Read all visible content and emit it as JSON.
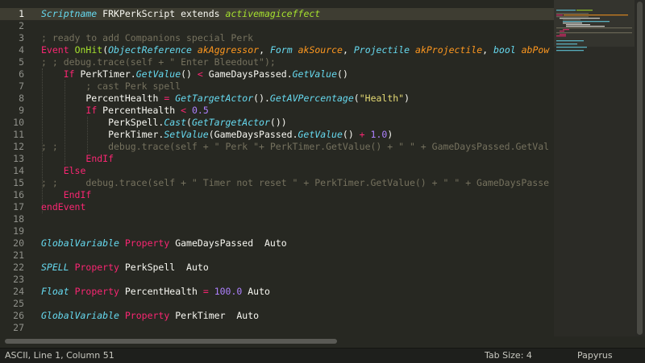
{
  "editor": {
    "active_line": 1,
    "lines": [
      {
        "n": "1",
        "parts": [
          {
            "t": "Scriptname",
            "c": "ty"
          },
          {
            "t": " FRKPerkScript ",
            "c": "pl"
          },
          {
            "t": "extends",
            "c": "pl"
          },
          {
            "t": " ",
            "c": "pl"
          },
          {
            "t": "activemagiceffect",
            "c": "ig"
          }
        ]
      },
      {
        "n": "2",
        "parts": []
      },
      {
        "n": "3",
        "parts": [
          {
            "t": "; ready to add Companions special Perk",
            "c": "cm"
          }
        ]
      },
      {
        "n": "4",
        "parts": [
          {
            "t": "Event",
            "c": "kw"
          },
          {
            "t": " ",
            "c": "pl"
          },
          {
            "t": "OnHit",
            "c": "fn"
          },
          {
            "t": "(",
            "c": "pl"
          },
          {
            "t": "ObjectReference",
            "c": "ty"
          },
          {
            "t": " ",
            "c": "pl"
          },
          {
            "t": "akAggressor",
            "c": "pm"
          },
          {
            "t": ", ",
            "c": "pl"
          },
          {
            "t": "Form",
            "c": "ty"
          },
          {
            "t": " ",
            "c": "pl"
          },
          {
            "t": "akSource",
            "c": "pm"
          },
          {
            "t": ", ",
            "c": "pl"
          },
          {
            "t": "Projectile",
            "c": "ty"
          },
          {
            "t": " ",
            "c": "pl"
          },
          {
            "t": "akProjectile",
            "c": "pm"
          },
          {
            "t": ", ",
            "c": "pl"
          },
          {
            "t": "bool",
            "c": "ty"
          },
          {
            "t": " ",
            "c": "pl"
          },
          {
            "t": "abPow",
            "c": "pm"
          }
        ]
      },
      {
        "n": "5",
        "parts": [
          {
            "t": "; ; debug.trace(self + \" Enter Bleedout\");",
            "c": "cm"
          }
        ]
      },
      {
        "n": "6",
        "parts": [
          {
            "t": "    ",
            "c": "pl"
          },
          {
            "t": "If",
            "c": "kw"
          },
          {
            "t": " PerkTimer.",
            "c": "pl"
          },
          {
            "t": "GetValue",
            "c": "ty"
          },
          {
            "t": "() ",
            "c": "pl"
          },
          {
            "t": "<",
            "c": "kw"
          },
          {
            "t": " GameDaysPassed.",
            "c": "pl"
          },
          {
            "t": "GetValue",
            "c": "ty"
          },
          {
            "t": "()",
            "c": "pl"
          }
        ]
      },
      {
        "n": "7",
        "parts": [
          {
            "t": "        ; cast Perk spell",
            "c": "cm"
          }
        ]
      },
      {
        "n": "8",
        "parts": [
          {
            "t": "        PercentHealth ",
            "c": "pl"
          },
          {
            "t": "=",
            "c": "kw"
          },
          {
            "t": " ",
            "c": "pl"
          },
          {
            "t": "GetTargetActor",
            "c": "ty"
          },
          {
            "t": "().",
            "c": "pl"
          },
          {
            "t": "GetAVPercentage",
            "c": "ty"
          },
          {
            "t": "(",
            "c": "pl"
          },
          {
            "t": "\"Health\"",
            "c": "st"
          },
          {
            "t": ")",
            "c": "pl"
          }
        ]
      },
      {
        "n": "9",
        "parts": [
          {
            "t": "        ",
            "c": "pl"
          },
          {
            "t": "If",
            "c": "kw"
          },
          {
            "t": " PercentHealth ",
            "c": "pl"
          },
          {
            "t": "<",
            "c": "kw"
          },
          {
            "t": " ",
            "c": "pl"
          },
          {
            "t": "0.5",
            "c": "nu"
          }
        ]
      },
      {
        "n": "10",
        "parts": [
          {
            "t": "            PerkSpell.",
            "c": "pl"
          },
          {
            "t": "Cast",
            "c": "ty"
          },
          {
            "t": "(",
            "c": "pl"
          },
          {
            "t": "GetTargetActor",
            "c": "ty"
          },
          {
            "t": "())",
            "c": "pl"
          }
        ]
      },
      {
        "n": "11",
        "parts": [
          {
            "t": "            PerkTimer.",
            "c": "pl"
          },
          {
            "t": "SetValue",
            "c": "ty"
          },
          {
            "t": "(GameDaysPassed.",
            "c": "pl"
          },
          {
            "t": "GetValue",
            "c": "ty"
          },
          {
            "t": "() ",
            "c": "pl"
          },
          {
            "t": "+",
            "c": "kw"
          },
          {
            "t": " ",
            "c": "pl"
          },
          {
            "t": "1.0",
            "c": "nu"
          },
          {
            "t": ")",
            "c": "pl"
          }
        ]
      },
      {
        "n": "12",
        "parts": [
          {
            "t": "; ;         debug.trace(self + \" Perk \"+ PerkTimer.GetValue() + \" \" + GameDaysPassed.GetVal",
            "c": "cm"
          }
        ]
      },
      {
        "n": "13",
        "parts": [
          {
            "t": "        ",
            "c": "pl"
          },
          {
            "t": "EndIf",
            "c": "kw"
          }
        ]
      },
      {
        "n": "14",
        "parts": [
          {
            "t": "    ",
            "c": "pl"
          },
          {
            "t": "Else",
            "c": "kw"
          }
        ]
      },
      {
        "n": "15",
        "parts": [
          {
            "t": "; ;     debug.trace(self + \" Timer not reset \" + PerkTimer.GetValue() + \" \" + GameDaysPasse",
            "c": "cm"
          }
        ]
      },
      {
        "n": "16",
        "parts": [
          {
            "t": "    ",
            "c": "pl"
          },
          {
            "t": "EndIf",
            "c": "kw"
          }
        ]
      },
      {
        "n": "17",
        "parts": [
          {
            "t": "endEvent",
            "c": "kw"
          }
        ]
      },
      {
        "n": "18",
        "parts": []
      },
      {
        "n": "19",
        "parts": []
      },
      {
        "n": "20",
        "parts": [
          {
            "t": "GlobalVariable",
            "c": "ty"
          },
          {
            "t": " ",
            "c": "pl"
          },
          {
            "t": "Property",
            "c": "kw"
          },
          {
            "t": " GameDaysPassed  ",
            "c": "pl"
          },
          {
            "t": "Auto",
            "c": "pl"
          }
        ]
      },
      {
        "n": "21",
        "parts": []
      },
      {
        "n": "22",
        "parts": [
          {
            "t": "SPELL",
            "c": "ty"
          },
          {
            "t": " ",
            "c": "pl"
          },
          {
            "t": "Property",
            "c": "kw"
          },
          {
            "t": " PerkSpell  ",
            "c": "pl"
          },
          {
            "t": "Auto",
            "c": "pl"
          }
        ]
      },
      {
        "n": "23",
        "parts": []
      },
      {
        "n": "24",
        "parts": [
          {
            "t": "Float",
            "c": "ty"
          },
          {
            "t": " ",
            "c": "pl"
          },
          {
            "t": "Property",
            "c": "kw"
          },
          {
            "t": " PercentHealth ",
            "c": "pl"
          },
          {
            "t": "=",
            "c": "kw"
          },
          {
            "t": " ",
            "c": "pl"
          },
          {
            "t": "100.0",
            "c": "nu"
          },
          {
            "t": " ",
            "c": "pl"
          },
          {
            "t": "Auto",
            "c": "pl"
          }
        ]
      },
      {
        "n": "25",
        "parts": []
      },
      {
        "n": "26",
        "parts": [
          {
            "t": "GlobalVariable",
            "c": "ty"
          },
          {
            "t": " ",
            "c": "pl"
          },
          {
            "t": "Property",
            "c": "kw"
          },
          {
            "t": " PerkTimer  ",
            "c": "pl"
          },
          {
            "t": "Auto",
            "c": "pl"
          }
        ]
      },
      {
        "n": "27",
        "parts": []
      }
    ]
  },
  "status": {
    "left": "ASCII, Line 1, Column 51",
    "tab_size": "Tab Size: 4",
    "syntax": "Papyrus"
  },
  "colors": {
    "background": "#272822",
    "keyword": "#f92672",
    "function": "#a6e22e",
    "type": "#66d9ef",
    "parameter": "#fd971f",
    "string": "#e6db74",
    "number": "#ae81ff",
    "comment": "#75715e"
  }
}
